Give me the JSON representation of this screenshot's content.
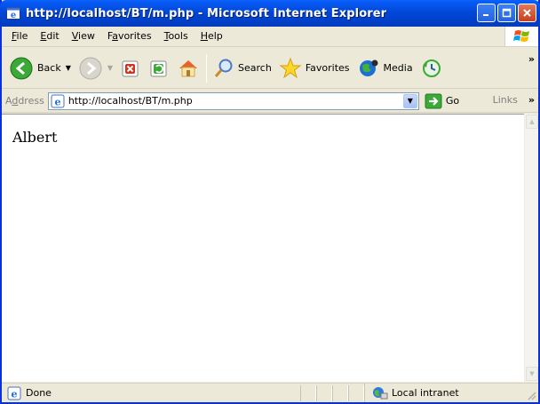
{
  "window": {
    "title": "http://localhost/BT/m.php - Microsoft Internet Explorer"
  },
  "menubar": {
    "items": [
      {
        "label": "File",
        "key": "F",
        "rest": "ile"
      },
      {
        "label": "Edit",
        "key": "E",
        "rest": "dit"
      },
      {
        "label": "View",
        "key": "V",
        "rest": "iew"
      },
      {
        "label": "Favorites",
        "pre": "F",
        "key": "a",
        "rest": "vorites"
      },
      {
        "label": "Tools",
        "key": "T",
        "rest": "ools"
      },
      {
        "label": "Help",
        "key": "H",
        "rest": "elp"
      }
    ]
  },
  "toolbar": {
    "back_label": "Back",
    "search_label": "Search",
    "favorites_label": "Favorites",
    "media_label": "Media"
  },
  "addressbar": {
    "label_pre": "A",
    "label_key": "d",
    "label_rest": "dress",
    "url": "http://localhost/BT/m.php",
    "go_label": "Go",
    "links_label": "Links"
  },
  "content": {
    "text": "Albert"
  },
  "statusbar": {
    "status": "Done",
    "zone": "Local intranet"
  },
  "colors": {
    "titlebar": "#0046d6",
    "frame": "#0831d9",
    "chrome": "#ece9d8"
  }
}
